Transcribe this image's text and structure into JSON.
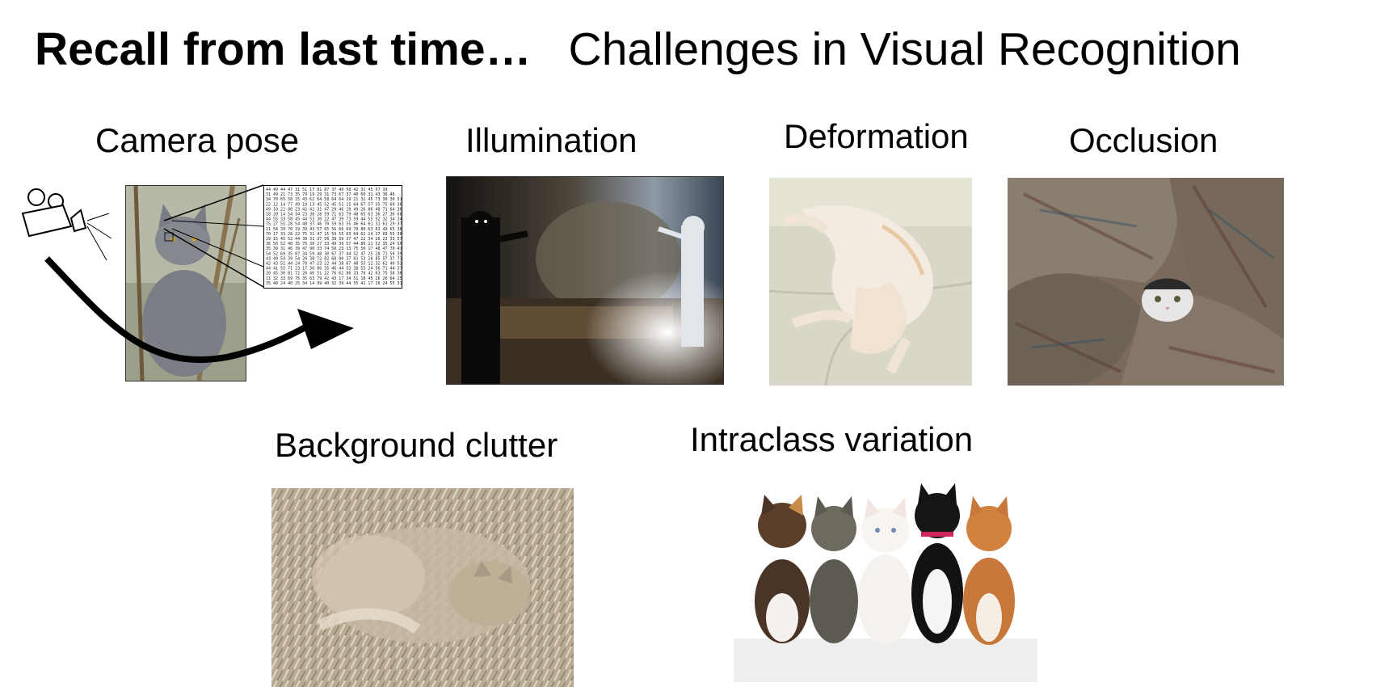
{
  "slide": {
    "title_bold": "Recall from last time…",
    "title_rest": "Challenges in Visual Recognition"
  },
  "panels": {
    "camera_pose": {
      "label": "Camera pose"
    },
    "illumination": {
      "label": "Illumination"
    },
    "deformation": {
      "label": "Deformation"
    },
    "occlusion": {
      "label": "Occlusion"
    },
    "background_clutter": {
      "label": "Background clutter"
    },
    "intraclass_variation": {
      "label": "Intraclass variation"
    }
  },
  "icons": {
    "camera": "movie-camera-icon",
    "arrow": "curved-arrow-icon"
  },
  "pixel_grid": {
    "rows": [
      "44 49 44 47 31 51 17 81 87 37 40 58 42 31 45 57 39",
      "31 49 21 73 35 79 19 29 31 73 67 37 40 60 31 43 36 40",
      "34 70 65 58 15 43 62 64 58 64 64 29 21 32 45 73 30 30 51",
      "22 12 14 77 49 19 13 45 52 45 51 15 64 67 57 55 75 69 36",
      "49 10 22 80 23 42 42 31 47 29 46 19 49 26 86 48 71 64 30",
      "18 20 14 54 34 23 36 28 59 71 63 79 48 65 63 36 27 36 68",
      "44 55 33 58 45 44 53 36 22 47 39 73 59 44 55 52 32 34 34",
      "75 27 55 28 54 48 37 46 70 59 63 55 46 64 61 31 61 29 37",
      "21 54 39 70 19 39 43 57 65 56 66 69 70 80 63 63 49 65 38",
      "70 17 33 28 22 75 31 47 15 59 55 63 64 62 14 17 69 55 30",
      "29 15 45 52 44 30 31 37 56 38 39 37 47 22 34 26 23 33 57",
      "36 50 52 40 35 76 30 27 33 49 39 57 44 80 21 52 35 24 50",
      "35 39 31 46 39 47 90 33 74 50 23 13 75 50 17 48 47 70 41",
      "54 52 69 35 87 34 59 48 30 67 37 44 52 47 25 28 71 50 39",
      "43 49 54 39 54 20 38 72 82 68 80 37 81 53 20 85 57 37 73",
      "42 43 52 44 24 70 47 23 22 44 38 67 48 55 12 32 62 40 53",
      "44 41 55 71 23 17 36 86 35 46 44 53 38 55 24 56 71 44 37",
      "20 45 36 81 72 20 46 51 22 76 62 80 33 78 42 63 75 58 36",
      "11 32 33 69 75 35 63 79 42 43 17 34 51 18 45 26 20 64 25",
      "35 40 24 40 25 34 14 99 40 32 39 44 55 41 17 20 24 55 31"
    ]
  }
}
